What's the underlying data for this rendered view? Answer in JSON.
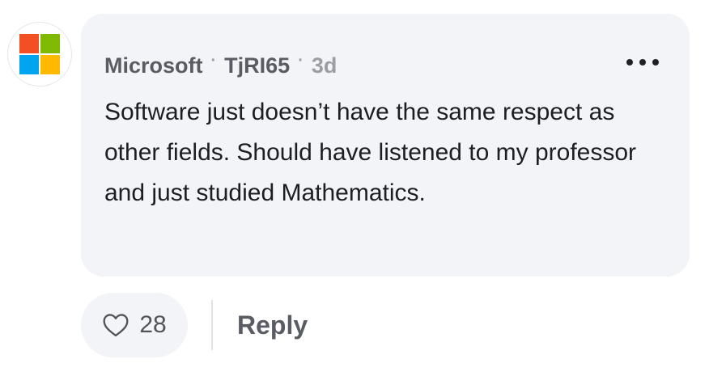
{
  "comment": {
    "author_company": "Microsoft",
    "author_handle": "TjRI65",
    "separator": "·",
    "age": "3d",
    "body": "Software just doesn’t have the same respect as other fields. Should have listened to my professor and just studied Mathematics."
  },
  "avatar": {
    "icon": "microsoft-logo",
    "colors": [
      "#f25022",
      "#7fba00",
      "#00a4ef",
      "#ffb900"
    ]
  },
  "actions": {
    "like_count": "28",
    "reply_label": "Reply",
    "more_icon": "more-horizontal-icon",
    "like_icon": "heart-outline-icon"
  }
}
